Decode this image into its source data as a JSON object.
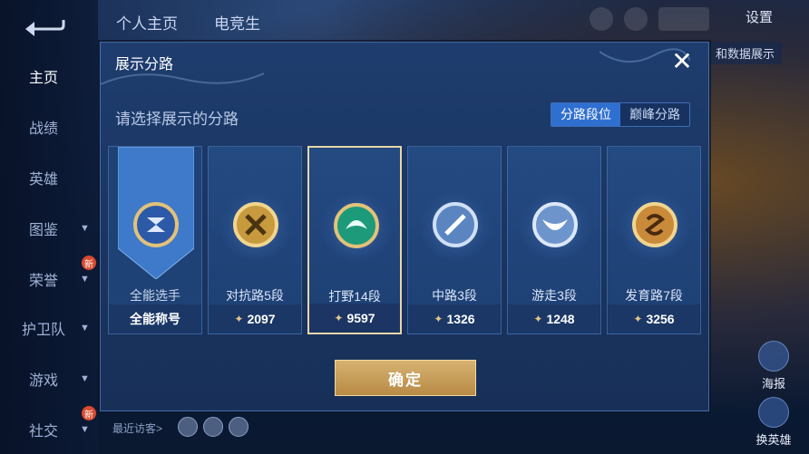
{
  "nav": {
    "items": [
      {
        "label": "主页",
        "active": true
      },
      {
        "label": "战绩"
      },
      {
        "label": "英雄"
      },
      {
        "label": "图鉴",
        "chevron": true
      },
      {
        "label": "荣誉",
        "chevron": true,
        "badge": "新"
      },
      {
        "label": "护卫队",
        "chevron": true
      },
      {
        "label": "游戏",
        "chevron": true
      },
      {
        "label": "社交",
        "chevron": true,
        "badge": "新"
      }
    ]
  },
  "topbar": {
    "tabs": [
      "个人主页",
      "电竞生"
    ],
    "settings": "设置",
    "data_show": "和数据展示"
  },
  "right": {
    "btn1": "海报",
    "btn2": "换英雄"
  },
  "bottom": {
    "recent": "最近访客>"
  },
  "modal": {
    "title": "展示分路",
    "prompt": "请选择展示的分路",
    "seg_on": "分路段位",
    "seg_off": "巅峰分路",
    "close_icon": "close-icon",
    "confirm": "确定",
    "cards": [
      {
        "label": "全能选手",
        "value": "全能称号",
        "emblem": "allround-emblem",
        "color": "#3b6fc2"
      },
      {
        "label": "对抗路5段",
        "value": "2097",
        "emblem": "clash-lane-emblem",
        "color": "#c79a3e"
      },
      {
        "label": "打野14段",
        "value": "9597",
        "emblem": "jungle-emblem",
        "color": "#1c9a7a",
        "selected": true
      },
      {
        "label": "中路3段",
        "value": "1326",
        "emblem": "mid-lane-emblem",
        "color": "#7aa6d8"
      },
      {
        "label": "游走3段",
        "value": "1248",
        "emblem": "roam-emblem",
        "color": "#8fb5e3"
      },
      {
        "label": "发育路7段",
        "value": "3256",
        "emblem": "farm-lane-emblem",
        "color": "#c98a3a"
      }
    ]
  }
}
